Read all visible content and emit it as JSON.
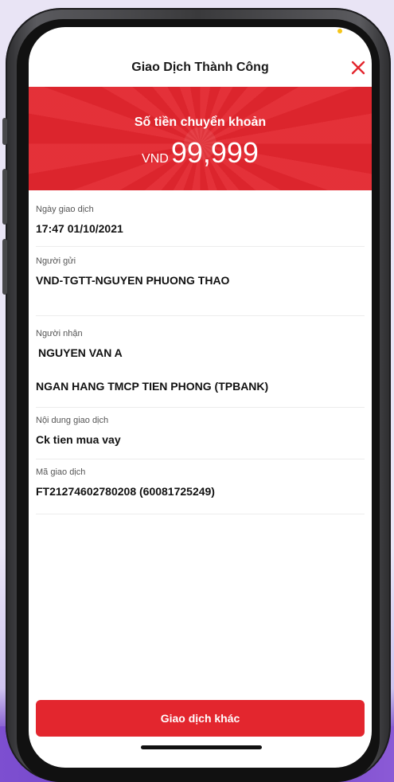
{
  "header": {
    "title": "Giao Dịch Thành Công",
    "close_icon": "close-icon"
  },
  "banner": {
    "label": "Số tiền chuyển khoản",
    "currency": "VND",
    "amount": "99,999"
  },
  "details": {
    "date": {
      "label": "Ngày giao dịch",
      "value": "17:47 01/10/2021"
    },
    "sender": {
      "label": "Người gửi",
      "value": "VND-TGTT-NGUYEN PHUONG THAO"
    },
    "recipient": {
      "label": "Người nhận",
      "name": "NGUYEN VAN A",
      "bank": "NGAN HANG TMCP TIEN PHONG (TPBANK)"
    },
    "content": {
      "label": "Nội dung giao dịch",
      "value": "Ck tien mua vay"
    },
    "txn_id": {
      "label": "Mã giao dịch",
      "value": "FT21274602780208 (60081725249)"
    }
  },
  "actions": {
    "other_transaction": "Giao dịch khác"
  },
  "colors": {
    "accent": "#e3262e",
    "background": "#e9e4f5",
    "band": "#6b3ec4"
  }
}
